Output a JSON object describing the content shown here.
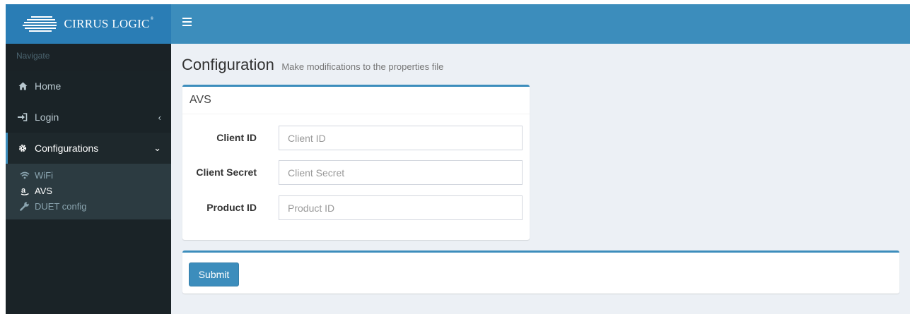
{
  "app": {
    "brand": "CIRRUS LOGIC",
    "brand_mark": "®"
  },
  "header": {
    "toggle_icon": "hamburger-icon"
  },
  "sidebar": {
    "header": "Navigate",
    "items": [
      {
        "label": "Home",
        "icon": "home-icon"
      },
      {
        "label": "Login",
        "icon": "sign-in-icon",
        "chevron": "‹"
      },
      {
        "label": "Configurations",
        "icon": "gear-icon",
        "chevron": "⌄",
        "active": true
      }
    ],
    "subitems": [
      {
        "label": "WiFi",
        "icon": "wifi-icon"
      },
      {
        "label": "AVS",
        "icon": "amazon-icon",
        "active": true
      },
      {
        "label": "DUET config",
        "icon": "wrench-icon"
      }
    ]
  },
  "page": {
    "title": "Configuration",
    "subtitle": "Make modifications to the properties file"
  },
  "avs_box": {
    "title": "AVS",
    "fields": [
      {
        "label": "Client ID",
        "placeholder": "Client ID",
        "value": ""
      },
      {
        "label": "Client Secret",
        "placeholder": "Client Secret",
        "value": ""
      },
      {
        "label": "Product ID",
        "placeholder": "Product ID",
        "value": ""
      }
    ]
  },
  "actions": {
    "submit_label": "Submit"
  },
  "colors": {
    "accent": "#3c8dbc",
    "logo_bg": "#2a7db5",
    "sidebar_bg": "#1a2327",
    "content_bg": "#ecf0f5"
  }
}
